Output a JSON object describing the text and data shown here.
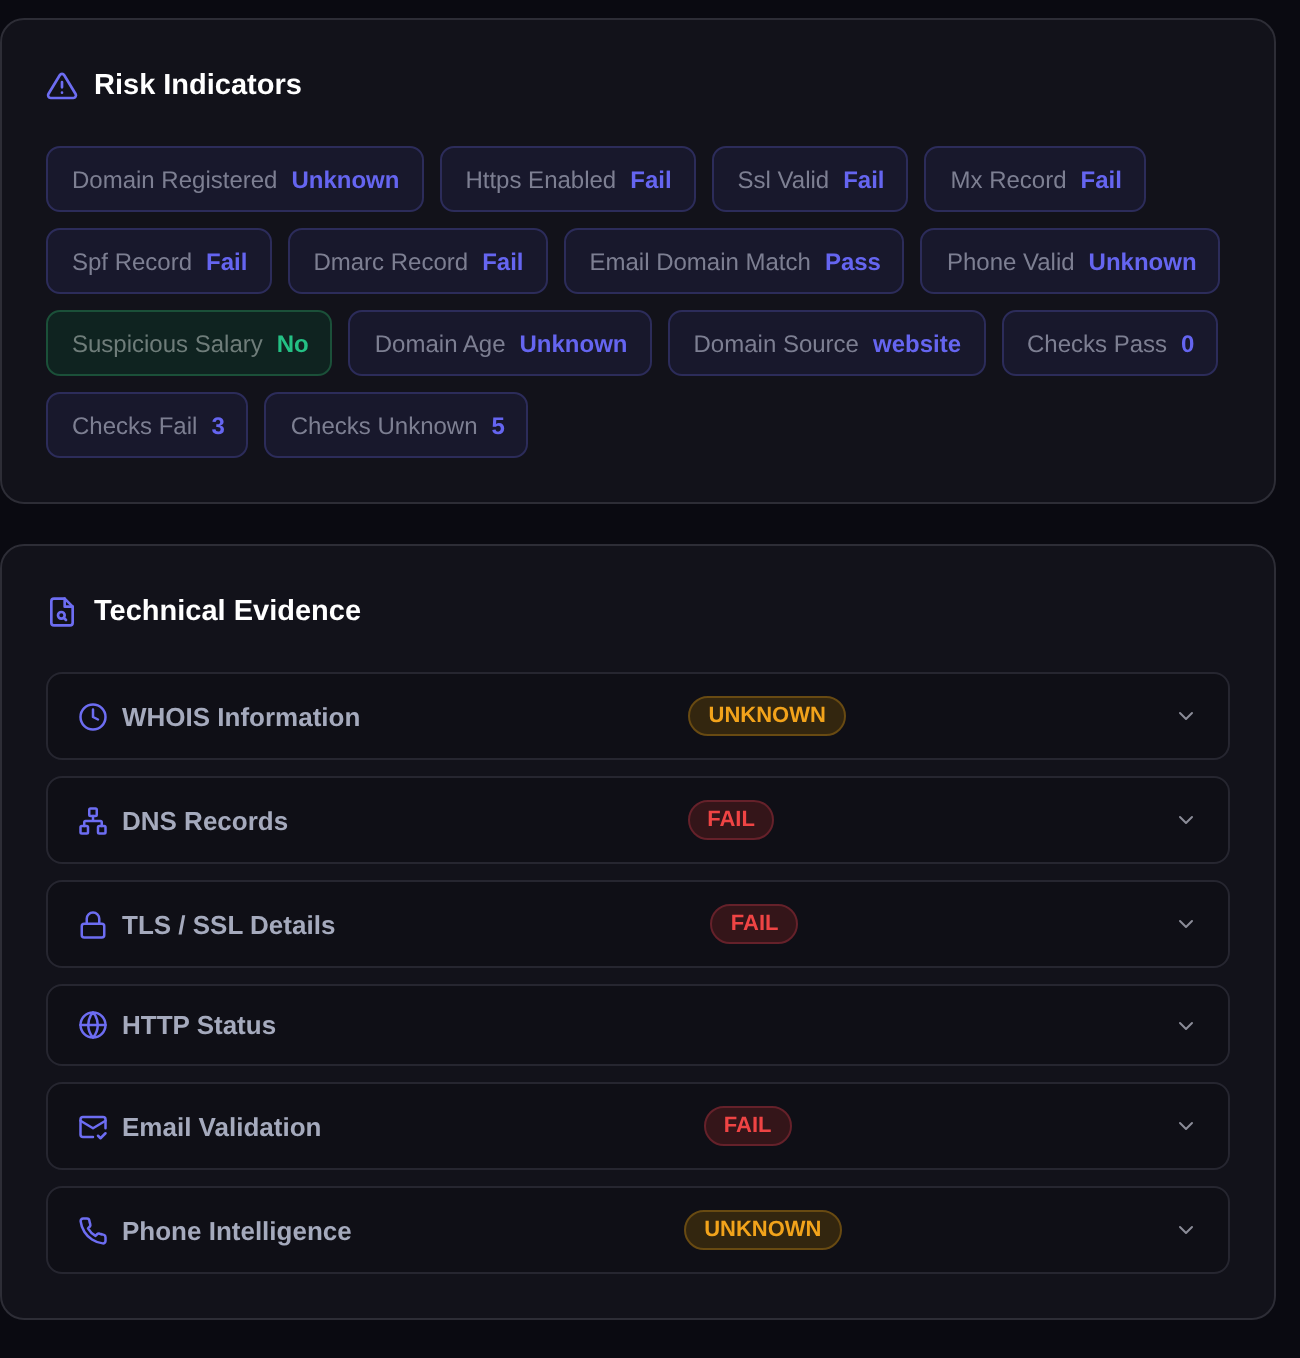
{
  "risk_indicators": {
    "title": "Risk Indicators",
    "chips": [
      {
        "label": "Domain Registered",
        "value": "Unknown",
        "positive": false
      },
      {
        "label": "Https Enabled",
        "value": "Fail",
        "positive": false
      },
      {
        "label": "Ssl Valid",
        "value": "Fail",
        "positive": false
      },
      {
        "label": "Mx Record",
        "value": "Fail",
        "positive": false
      },
      {
        "label": "Spf Record",
        "value": "Fail",
        "positive": false
      },
      {
        "label": "Dmarc Record",
        "value": "Fail",
        "positive": false
      },
      {
        "label": "Email Domain Match",
        "value": "Pass",
        "positive": false
      },
      {
        "label": "Phone Valid",
        "value": "Unknown",
        "positive": false
      },
      {
        "label": "Suspicious Salary",
        "value": "No",
        "positive": true
      },
      {
        "label": "Domain Age",
        "value": "Unknown",
        "positive": false
      },
      {
        "label": "Domain Source",
        "value": "website",
        "positive": false
      },
      {
        "label": "Checks Pass",
        "value": "0",
        "positive": false
      },
      {
        "label": "Checks Fail",
        "value": "3",
        "positive": false
      },
      {
        "label": "Checks Unknown",
        "value": "5",
        "positive": false
      }
    ]
  },
  "technical_evidence": {
    "title": "Technical Evidence",
    "sections": [
      {
        "title": "WHOIS Information",
        "status_label": "UNKNOWN",
        "failed": false,
        "expanded": false
      },
      {
        "title": "DNS Records",
        "status_label": "FAIL",
        "failed": true,
        "expanded": false
      },
      {
        "title": "TLS / SSL Details",
        "status_label": "FAIL",
        "failed": true,
        "expanded": false
      },
      {
        "title": "HTTP Status",
        "expanded": false
      },
      {
        "title": "Email Validation",
        "status_label": "FAIL",
        "failed": true,
        "expanded": false
      },
      {
        "title": "Phone Intelligence",
        "status_label": "UNKNOWN",
        "failed": false,
        "expanded": false
      }
    ]
  }
}
